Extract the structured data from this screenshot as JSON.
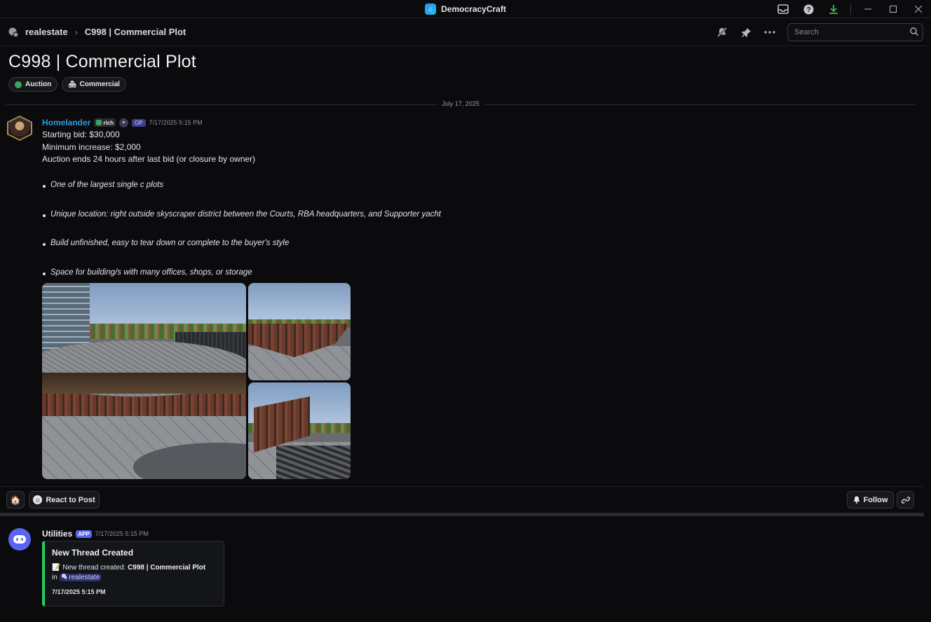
{
  "window": {
    "app_title": "DemocracyCraft"
  },
  "header": {
    "channel": "realestate",
    "thread": "C998 | Commercial Plot",
    "search_placeholder": "Search"
  },
  "post": {
    "title": "C998 | Commercial Plot",
    "tags": [
      {
        "label": "Auction",
        "color": "#3ba55c"
      },
      {
        "label": "Commercial",
        "icon": "🏘"
      }
    ],
    "date_divider": "July 17, 2025"
  },
  "message": {
    "author": "Homelander",
    "role": "rich",
    "op_badge": "OP",
    "timestamp": "7/17/2025 5:15 PM",
    "lines": [
      "Starting bid: $30,000",
      "Minimum increase: $2,000",
      "Auction ends 24 hours after last bid (or closure by owner)"
    ],
    "bullets": [
      "One of the largest single c plots",
      "Unique location: right outside skyscraper district between the Courts, RBA headquarters, and Supporter yacht",
      "Build unfinished, easy to tear down or complete to the buyer's style",
      "Space for building/s with many offices, shops, or storage"
    ]
  },
  "reactions": {
    "emoji": "🏠",
    "react_label": "React to Post",
    "follow_label": "Follow"
  },
  "utilities": {
    "name": "Utilities",
    "app_badge": "APP",
    "timestamp": "7/17/2025 5:15 PM",
    "embed": {
      "title": "New Thread Created",
      "emoji": "📝",
      "line_prefix": "New thread created:",
      "thread_name": "C998 | Commercial Plot",
      "in_label": "in",
      "channel": "realestate",
      "time": "7/17/2025 5:15 PM",
      "accent": "#23d160"
    }
  }
}
